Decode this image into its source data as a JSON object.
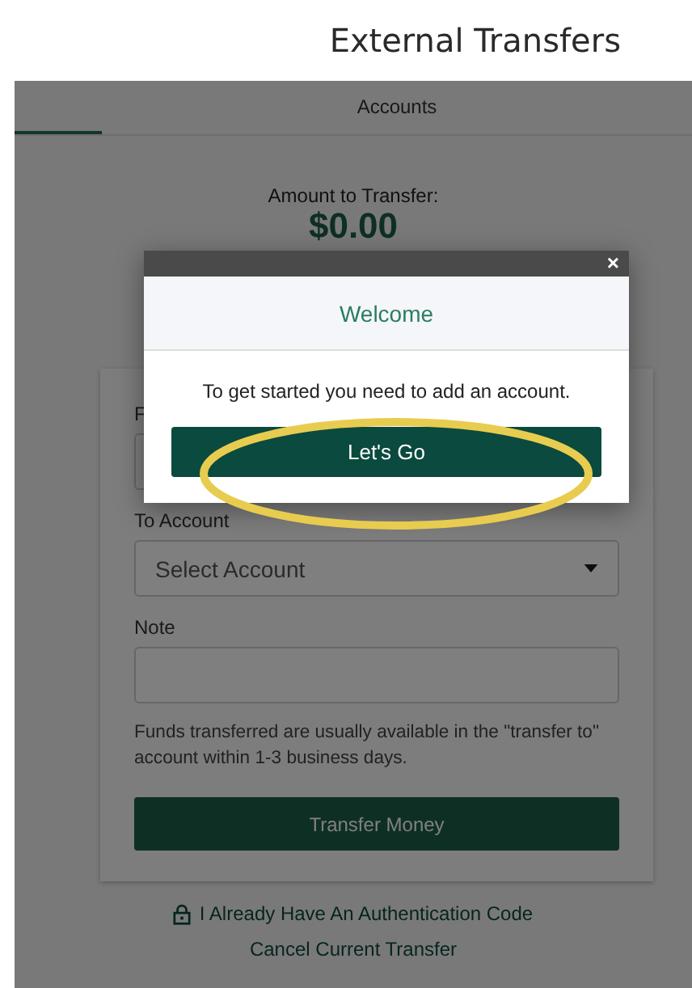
{
  "page_title": "External Transfers",
  "tabs": [
    {
      "selected": true
    },
    {
      "label": "Accounts",
      "selected": false
    }
  ],
  "amount": {
    "label": "Amount to Transfer:",
    "value": "$0.00"
  },
  "form": {
    "from_label": "F",
    "to_label": "To Account",
    "to_placeholder": "Select Account",
    "note_label": "Note",
    "info": "Funds transferred are usually available in the \"transfer to\" account within 1-3 business days.",
    "submit": "Transfer Money"
  },
  "links": [
    {
      "kind": "lock",
      "label": "I Already Have An Authentication Code"
    },
    {
      "kind": "plain",
      "label": "Cancel Current Transfer"
    }
  ],
  "modal": {
    "close": "×",
    "title": "Welcome",
    "message": "To get started you need to add an account.",
    "button": "Let's Go",
    "highlighted": true
  }
}
